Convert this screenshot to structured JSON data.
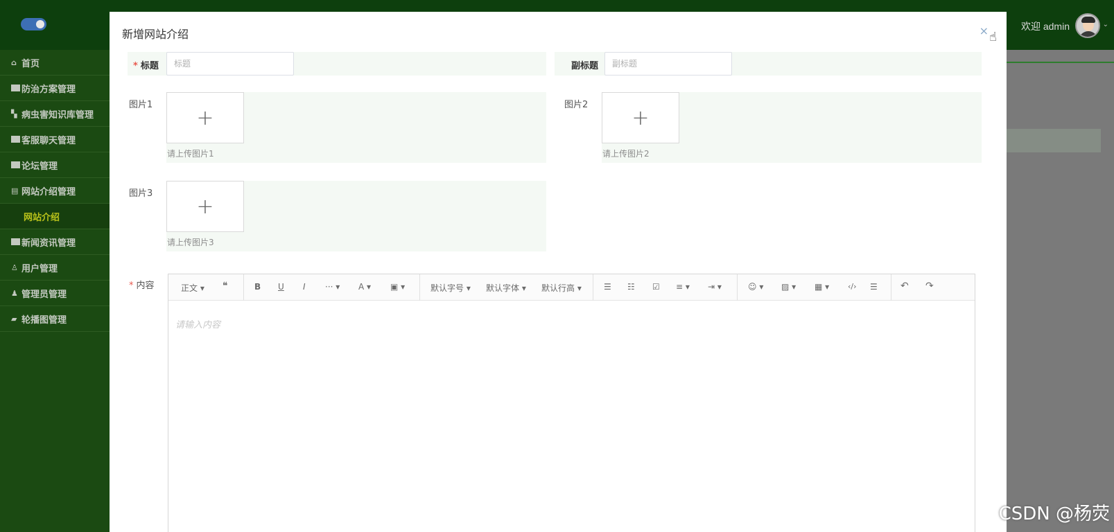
{
  "header": {
    "welcome": "欢迎 admin",
    "caret": "⌄"
  },
  "sidebar": {
    "items": [
      {
        "label": "首页",
        "icon": "home-icon"
      },
      {
        "label": "防治方案管理",
        "icon": "list-icon"
      },
      {
        "label": "病虫害知识库管理",
        "icon": "grid-icon"
      },
      {
        "label": "客服聊天管理",
        "icon": "list-icon"
      },
      {
        "label": "论坛管理",
        "icon": "list-icon"
      },
      {
        "label": "网站介绍管理",
        "icon": "briefcase-icon"
      },
      {
        "label": "网站介绍",
        "sub": true
      },
      {
        "label": "新闻资讯管理",
        "icon": "list-icon"
      },
      {
        "label": "用户管理",
        "icon": "user-icon"
      },
      {
        "label": "管理员管理",
        "icon": "user-icon"
      },
      {
        "label": "轮播图管理",
        "icon": "folder-icon"
      }
    ]
  },
  "modal": {
    "title": "新增网站介绍",
    "close": "×",
    "form": {
      "title_label": "标题",
      "title_placeholder": "标题",
      "subtitle_label": "副标题",
      "subtitle_placeholder": "副标题",
      "image1_label": "图片1",
      "image1_hint": "请上传图片1",
      "image2_label": "图片2",
      "image2_hint": "请上传图片2",
      "image3_label": "图片3",
      "image3_hint": "请上传图片3",
      "content_label": "内容",
      "content_placeholder": "请输入内容",
      "required_mark": "*",
      "plus": "+"
    },
    "toolbar": {
      "paragraph": "正文 ▾",
      "quote": "❝",
      "bold": "B",
      "underline": "U",
      "italic": "I",
      "more": "··· ▾",
      "font_color": "A ▾",
      "bg_color": "▣ ▾",
      "font_size": "默认字号 ▾",
      "font_family": "默认字体 ▾",
      "line_height": "默认行高 ▾",
      "bullet_list": "☰",
      "ordered_list": "☷",
      "todo": "☑",
      "align": "≡ ▾",
      "indent": "⇥ ▾",
      "emoji": "☺ ▾",
      "image": "▨ ▾",
      "table": "▦ ▾",
      "code": "‹/›",
      "divider": "☰",
      "undo": "↶",
      "redo": "↷"
    }
  },
  "watermark": "CSDN @杨荧",
  "colors": {
    "header_bg": "#0d3f0d",
    "sidebar_bg": "#1b4a12",
    "active_sub": "#b9c21a",
    "required": "#e85a4f"
  }
}
